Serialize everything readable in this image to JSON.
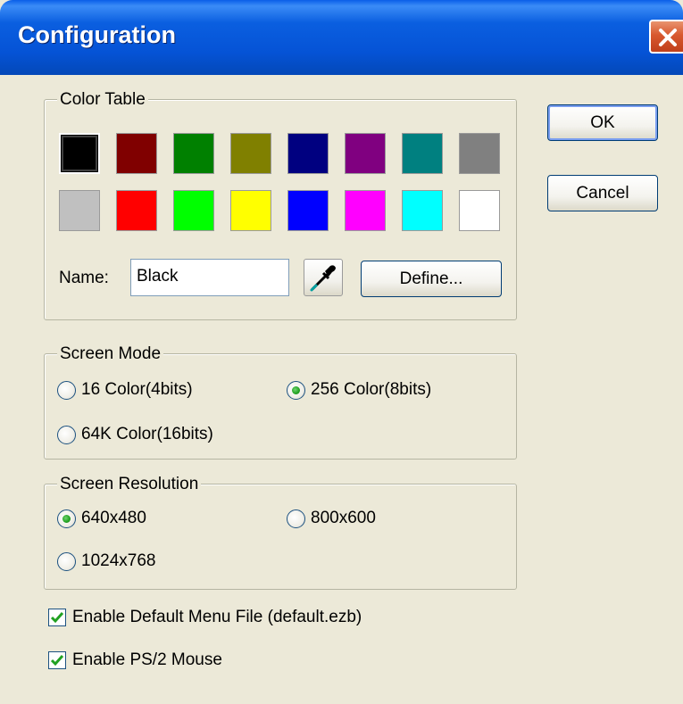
{
  "window": {
    "title": "Configuration"
  },
  "color_table": {
    "legend": "Color Table",
    "swatches": [
      {
        "name": "black",
        "color": "#000000",
        "selected": true
      },
      {
        "name": "maroon",
        "color": "#800000"
      },
      {
        "name": "green",
        "color": "#008000"
      },
      {
        "name": "olive",
        "color": "#808000"
      },
      {
        "name": "navy",
        "color": "#000080"
      },
      {
        "name": "purple",
        "color": "#800080"
      },
      {
        "name": "teal",
        "color": "#008080"
      },
      {
        "name": "gray",
        "color": "#808080"
      },
      {
        "name": "silver",
        "color": "#c0c0c0"
      },
      {
        "name": "red",
        "color": "#ff0000"
      },
      {
        "name": "lime",
        "color": "#00ff00"
      },
      {
        "name": "yellow",
        "color": "#ffff00"
      },
      {
        "name": "blue",
        "color": "#0000ff"
      },
      {
        "name": "fuchsia",
        "color": "#ff00ff"
      },
      {
        "name": "aqua",
        "color": "#00ffff"
      },
      {
        "name": "white",
        "color": "#ffffff"
      }
    ],
    "name_label": "Name:",
    "name_value": "Black",
    "picker_icon": "eyedropper-icon",
    "define_label": "Define..."
  },
  "buttons": {
    "ok_label": "OK",
    "cancel_label": "Cancel"
  },
  "screen_mode": {
    "legend": "Screen Mode",
    "options": [
      {
        "label": "16 Color(4bits)",
        "selected": false
      },
      {
        "label": "256 Color(8bits)",
        "selected": true
      },
      {
        "label": "64K Color(16bits)",
        "selected": false
      }
    ]
  },
  "screen_resolution": {
    "legend": "Screen Resolution",
    "options": [
      {
        "label": "640x480",
        "selected": true
      },
      {
        "label": "800x600",
        "selected": false
      },
      {
        "label": "1024x768",
        "selected": false
      }
    ]
  },
  "checkboxes": [
    {
      "label": "Enable Default Menu File (default.ezb)",
      "checked": true
    },
    {
      "label": "Enable PS/2 Mouse",
      "checked": true
    }
  ],
  "colors": {
    "title_bar": "#0553d6",
    "close_button": "#d8582e",
    "dialog_bg": "#ece9d8",
    "check_mark": "#21a121"
  }
}
